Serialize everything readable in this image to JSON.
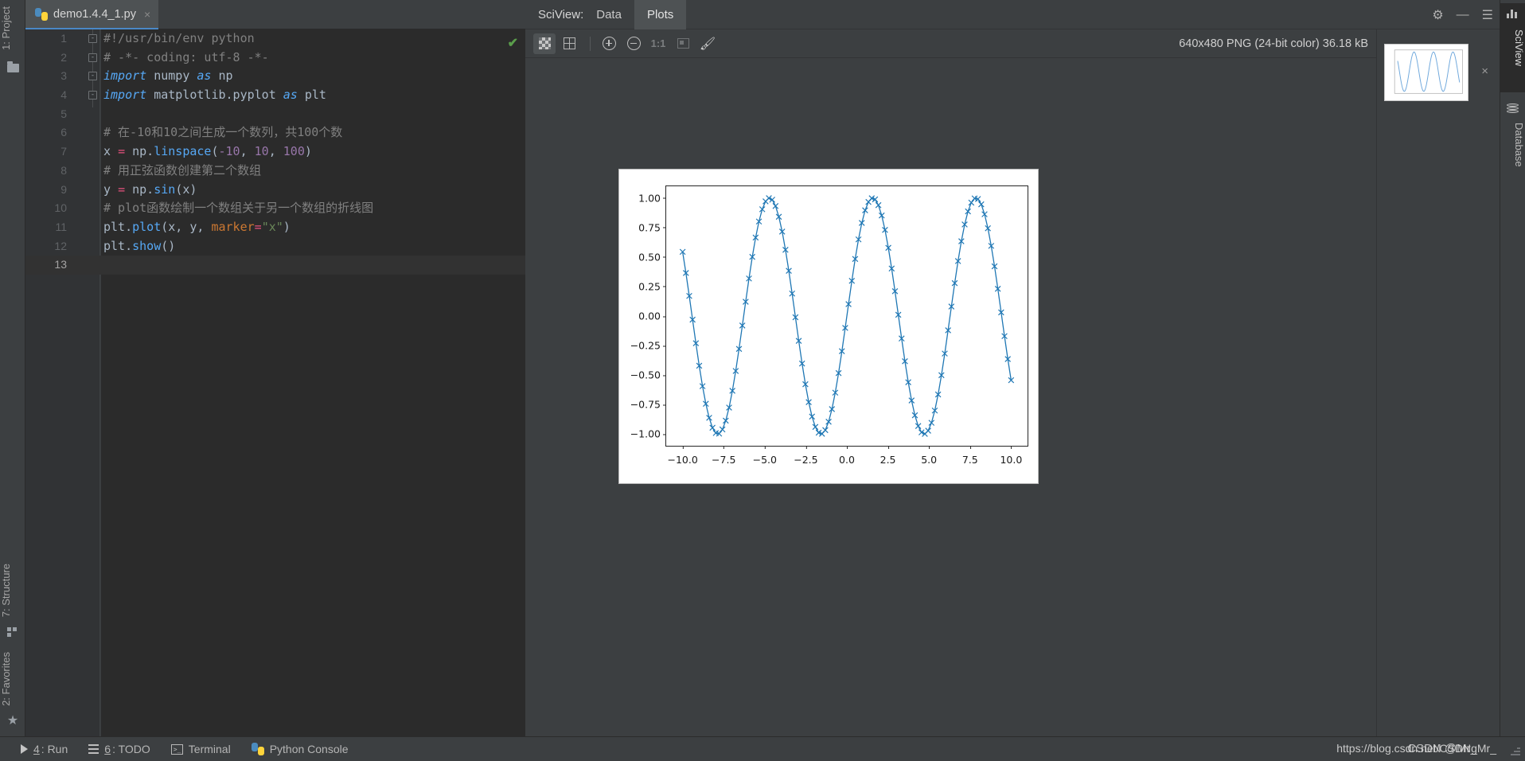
{
  "left_strip": {
    "tabs": [
      {
        "label": "1: Project",
        "icon": "folder-icon"
      },
      {
        "label": "7: Structure",
        "icon": "structure-icon"
      },
      {
        "label": "2: Favorites",
        "icon": "star-icon"
      }
    ]
  },
  "right_strip": {
    "tabs": [
      {
        "label": "SciView",
        "icon": "bar-chart-icon",
        "active": true
      },
      {
        "label": "Database",
        "icon": "database-icon",
        "active": false
      }
    ]
  },
  "editor": {
    "tab": {
      "filename": "demo1.4.4_1.py",
      "icon": "python-file-icon",
      "close": "×"
    },
    "inspection_status_icon": "checkmark-ok-icon",
    "lines": [
      {
        "n": "1",
        "fold": "-",
        "tokens": [
          {
            "t": "#!/usr/bin/env python",
            "c": "tok-comment"
          }
        ]
      },
      {
        "n": "2",
        "fold": "-",
        "tokens": [
          {
            "t": "# -*- coding: utf-8 -*-",
            "c": "tok-comment"
          }
        ]
      },
      {
        "n": "3",
        "fold": "-",
        "tokens": [
          {
            "t": "import ",
            "c": "tok-kw"
          },
          {
            "t": "numpy ",
            "c": "tok-plain"
          },
          {
            "t": "as ",
            "c": "tok-kw"
          },
          {
            "t": "np",
            "c": "tok-plain"
          }
        ]
      },
      {
        "n": "4",
        "fold": "-",
        "tokens": [
          {
            "t": "import ",
            "c": "tok-kw"
          },
          {
            "t": "matplotlib.pyplot ",
            "c": "tok-plain"
          },
          {
            "t": "as ",
            "c": "tok-kw"
          },
          {
            "t": "plt",
            "c": "tok-plain"
          }
        ]
      },
      {
        "n": "5",
        "fold": "",
        "tokens": [
          {
            "t": "",
            "c": "tok-plain"
          }
        ]
      },
      {
        "n": "6",
        "fold": "",
        "tokens": [
          {
            "t": "# 在-10和10之间生成一个数列，共100个数",
            "c": "tok-comment"
          }
        ]
      },
      {
        "n": "7",
        "fold": "",
        "tokens": [
          {
            "t": "x ",
            "c": "tok-plain"
          },
          {
            "t": "= ",
            "c": "tok-op"
          },
          {
            "t": "np.",
            "c": "tok-plain"
          },
          {
            "t": "linspace",
            "c": "tok-func"
          },
          {
            "t": "(",
            "c": "tok-plain"
          },
          {
            "t": "-10",
            "c": "tok-num"
          },
          {
            "t": ", ",
            "c": "tok-plain"
          },
          {
            "t": "10",
            "c": "tok-num"
          },
          {
            "t": ", ",
            "c": "tok-plain"
          },
          {
            "t": "100",
            "c": "tok-num"
          },
          {
            "t": ")",
            "c": "tok-plain"
          }
        ]
      },
      {
        "n": "8",
        "fold": "",
        "tokens": [
          {
            "t": "# 用正弦函数创建第二个数组",
            "c": "tok-comment"
          }
        ]
      },
      {
        "n": "9",
        "fold": "",
        "tokens": [
          {
            "t": "y ",
            "c": "tok-plain"
          },
          {
            "t": "= ",
            "c": "tok-op"
          },
          {
            "t": "np.",
            "c": "tok-plain"
          },
          {
            "t": "sin",
            "c": "tok-func"
          },
          {
            "t": "(x)",
            "c": "tok-plain"
          }
        ]
      },
      {
        "n": "10",
        "fold": "",
        "tokens": [
          {
            "t": "# plot函数绘制一个数组关于另一个数组的折线图",
            "c": "tok-comment"
          }
        ]
      },
      {
        "n": "11",
        "fold": "",
        "tokens": [
          {
            "t": "plt.",
            "c": "tok-plain"
          },
          {
            "t": "plot",
            "c": "tok-func"
          },
          {
            "t": "(x, y, ",
            "c": "tok-plain"
          },
          {
            "t": "marker",
            "c": "tok-kwarg"
          },
          {
            "t": "=",
            "c": "tok-op"
          },
          {
            "t": "\"x\"",
            "c": "tok-str"
          },
          {
            "t": ")",
            "c": "tok-plain"
          }
        ]
      },
      {
        "n": "12",
        "fold": "",
        "tokens": [
          {
            "t": "plt.",
            "c": "tok-plain"
          },
          {
            "t": "show",
            "c": "tok-func"
          },
          {
            "t": "()",
            "c": "tok-plain"
          }
        ]
      },
      {
        "n": "13",
        "fold": "",
        "tokens": [
          {
            "t": "",
            "c": "tok-plain"
          }
        ],
        "current": true
      }
    ]
  },
  "sciview": {
    "title": "SciView:",
    "tabs": [
      {
        "label": "Data",
        "active": false
      },
      {
        "label": "Plots",
        "active": true
      }
    ],
    "header_icons": [
      {
        "name": "settings-gear-icon",
        "glyph": "⚙"
      },
      {
        "name": "minimize-icon",
        "glyph": "—"
      },
      {
        "name": "hide-panel-icon",
        "glyph": "☰"
      }
    ],
    "toolbar": {
      "buttons": [
        {
          "name": "transparency-checker-button",
          "active": true
        },
        {
          "name": "grid-toggle-button",
          "active": false
        },
        {
          "name": "zoom-in-button",
          "active": false
        },
        {
          "name": "zoom-out-button",
          "active": false
        },
        {
          "name": "actual-size-button",
          "label": "1:1",
          "active": false
        },
        {
          "name": "fit-to-window-button",
          "active": false
        },
        {
          "name": "color-picker-button",
          "active": false
        }
      ],
      "image_info": "640x480 PNG (24-bit color) 36.18 kB"
    },
    "thumbnail": {
      "close_glyph": "×"
    }
  },
  "chart_data": {
    "type": "line",
    "title": "",
    "xlabel": "",
    "ylabel": "",
    "marker": "x",
    "line_color": "#1f77b4",
    "xlim": [
      -11.0,
      11.0
    ],
    "ylim": [
      -1.1,
      1.1
    ],
    "grid": false,
    "legend": null,
    "xticks": [
      "−10.0",
      "−7.5",
      "−5.0",
      "−2.5",
      "0.0",
      "2.5",
      "5.0",
      "7.5",
      "10.0"
    ],
    "xtick_values": [
      -10.0,
      -7.5,
      -5.0,
      -2.5,
      0.0,
      2.5,
      5.0,
      7.5,
      10.0
    ],
    "yticks": [
      "1.00",
      "0.75",
      "0.50",
      "0.25",
      "0.00",
      "−0.25",
      "−0.50",
      "−0.75",
      "−1.00"
    ],
    "ytick_values": [
      1.0,
      0.75,
      0.5,
      0.25,
      0.0,
      -0.25,
      -0.5,
      -0.75,
      -1.0
    ],
    "series": [
      {
        "name": "y = np.sin(x)",
        "x_start": -10,
        "x_end": 10,
        "n_points": 100,
        "function": "sin"
      }
    ]
  },
  "statusbar": {
    "items": [
      {
        "num": "4",
        "label": ": Run",
        "icon": "run-triangle-icon"
      },
      {
        "num": "6",
        "label": ": TODO",
        "icon": "todo-list-icon"
      },
      {
        "num": "",
        "label": "Terminal",
        "icon": "terminal-icon"
      },
      {
        "num": "",
        "label": "Python Console",
        "icon": "python-icon"
      }
    ],
    "watermark": "https://blog.csdn.net/CSDNgMr_",
    "watermark_overlay": "CSDN @Mr_"
  }
}
